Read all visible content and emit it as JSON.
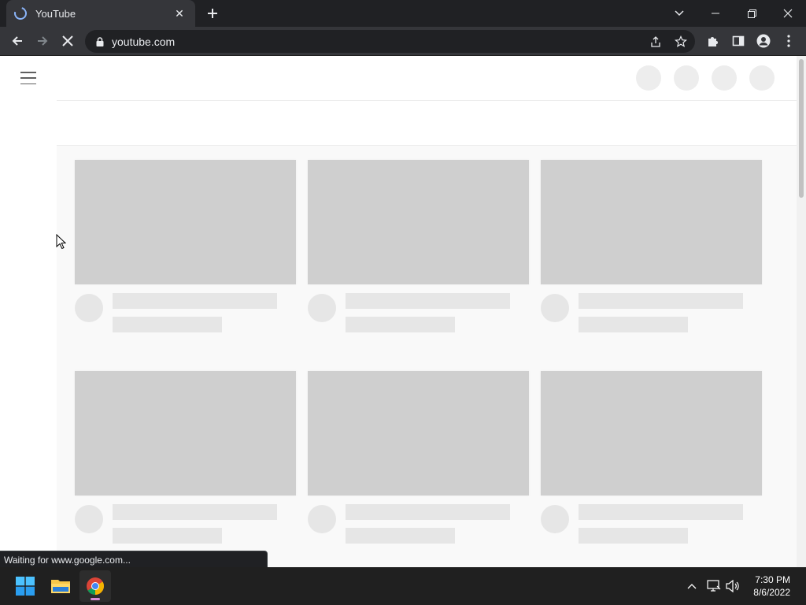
{
  "browser": {
    "tab": {
      "title": "YouTube",
      "close_glyph": "✕"
    },
    "new_tab_icon": "plus-icon",
    "omnibox": {
      "url": "youtube.com"
    },
    "window_controls": [
      "chevron-down-icon",
      "minimize-icon",
      "restore-icon",
      "close-icon"
    ],
    "status_text": "Waiting for www.google.com..."
  },
  "taskbar": {
    "apps": [
      "windows-start-icon",
      "file-explorer-icon",
      "chrome-icon"
    ],
    "tray": [
      "chevron-up-icon",
      "network-icon",
      "volume-icon"
    ],
    "time": "7:30 PM",
    "date": "8/6/2022"
  },
  "page": {
    "skeleton_cards": [
      {
        "row": 1,
        "col": 1
      },
      {
        "row": 1,
        "col": 2
      },
      {
        "row": 1,
        "col": 3
      },
      {
        "row": 2,
        "col": 1
      },
      {
        "row": 2,
        "col": 2
      },
      {
        "row": 2,
        "col": 3
      }
    ],
    "masthead_placeholders": 4
  },
  "colors": {
    "chrome_dark": "#202124",
    "chrome_toolbar": "#35363a",
    "skeleton_thumb": "#cfcfcf",
    "skeleton_line": "#e6e6e6",
    "page_bg": "#f9f9f9",
    "taskbar": "#202020"
  }
}
